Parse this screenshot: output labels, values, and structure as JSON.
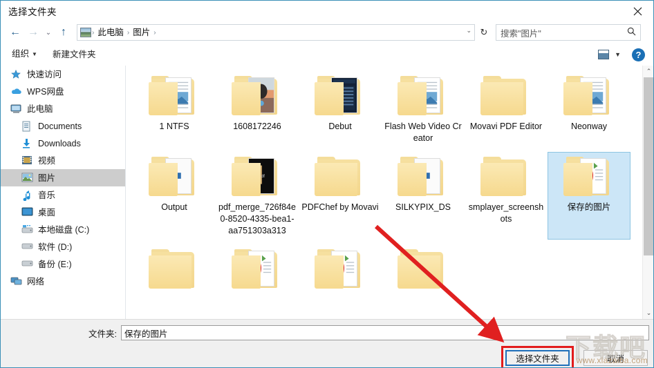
{
  "window": {
    "title": "选择文件夹",
    "close_label": "✕"
  },
  "nav": {
    "back_icon": "←",
    "forward_icon": "→",
    "recent_icon": "⌄",
    "up_icon": "↑",
    "refresh_icon": "↻",
    "breadcrumb": [
      "此电脑",
      "图片"
    ],
    "breadcrumb_sep": "›",
    "address_dropdown_icon": "⌄"
  },
  "search": {
    "placeholder": "搜索\"图片\"",
    "icon": "search-icon"
  },
  "toolbar": {
    "organize_label": "组织",
    "organize_caret": "▼",
    "new_folder_label": "新建文件夹",
    "view_caret": "▼",
    "help_label": "?"
  },
  "sidebar": {
    "items": [
      {
        "label": "快速访问",
        "icon": "star-icon",
        "level": 0,
        "selected": false
      },
      {
        "label": "WPS网盘",
        "icon": "cloud-icon",
        "level": 0,
        "selected": false
      },
      {
        "label": "此电脑",
        "icon": "computer-icon",
        "level": 0,
        "selected": false
      },
      {
        "label": "Documents",
        "icon": "documents-icon",
        "level": 1,
        "selected": false
      },
      {
        "label": "Downloads",
        "icon": "downloads-icon",
        "level": 1,
        "selected": false
      },
      {
        "label": "视频",
        "icon": "video-icon",
        "level": 1,
        "selected": false
      },
      {
        "label": "图片",
        "icon": "pictures-icon",
        "level": 1,
        "selected": true
      },
      {
        "label": "音乐",
        "icon": "music-icon",
        "level": 1,
        "selected": false
      },
      {
        "label": "桌面",
        "icon": "desktop-icon",
        "level": 1,
        "selected": false
      },
      {
        "label": "本地磁盘 (C:)",
        "icon": "disk-c-icon",
        "level": 1,
        "selected": false
      },
      {
        "label": "软件 (D:)",
        "icon": "disk-d-icon",
        "level": 1,
        "selected": false
      },
      {
        "label": "备份 (E:)",
        "icon": "disk-e-icon",
        "level": 1,
        "selected": false
      },
      {
        "label": "网络",
        "icon": "network-icon",
        "level": 0,
        "selected": false
      }
    ]
  },
  "files": {
    "items": [
      {
        "name": "1 NTFS",
        "type": "folder-with-image",
        "selected": false
      },
      {
        "name": "1608172246",
        "type": "folder-with-photo",
        "selected": false
      },
      {
        "name": "Debut",
        "type": "folder-with-screenshot",
        "selected": false
      },
      {
        "name": "Flash Web Video Creator",
        "type": "folder-with-image",
        "selected": false
      },
      {
        "name": "Movavi PDF Editor",
        "type": "folder-plain",
        "selected": false
      },
      {
        "name": "Neonway",
        "type": "folder-with-image",
        "selected": false
      },
      {
        "name": "Output",
        "type": "folder-with-doc",
        "selected": false
      },
      {
        "name": "pdf_merge_726f84e0-8520-4335-bea1-aa751303a313",
        "type": "folder-with-dark",
        "selected": false
      },
      {
        "name": "PDFChef by Movavi",
        "type": "folder-plain",
        "selected": false
      },
      {
        "name": "SILKYPIX_DS",
        "type": "folder-with-doc",
        "selected": false
      },
      {
        "name": "smplayer_screenshots",
        "type": "folder-plain",
        "selected": false
      },
      {
        "name": "保存的图片",
        "type": "folder-with-strawberry",
        "selected": true
      },
      {
        "name": "",
        "type": "folder-plain",
        "selected": false
      },
      {
        "name": "",
        "type": "folder-with-strawberry",
        "selected": false
      },
      {
        "name": "",
        "type": "folder-with-strawberry",
        "selected": false
      },
      {
        "name": "",
        "type": "folder-plain",
        "selected": false
      }
    ]
  },
  "scrollbar": {
    "up_icon": "⌃",
    "down_icon": "⌄"
  },
  "footer": {
    "folder_label": "文件夹:",
    "folder_value": "保存的图片",
    "select_button": "选择文件夹",
    "cancel_button": "取消"
  },
  "watermark": {
    "glyphs": "下载吧",
    "url": "www.xiazaiba.com"
  },
  "colors": {
    "selection_blue": "#cce6f7",
    "highlight_red": "#e21b1b",
    "accent_blue": "#1f6fba",
    "folder_yellow": "#f3d68c"
  }
}
